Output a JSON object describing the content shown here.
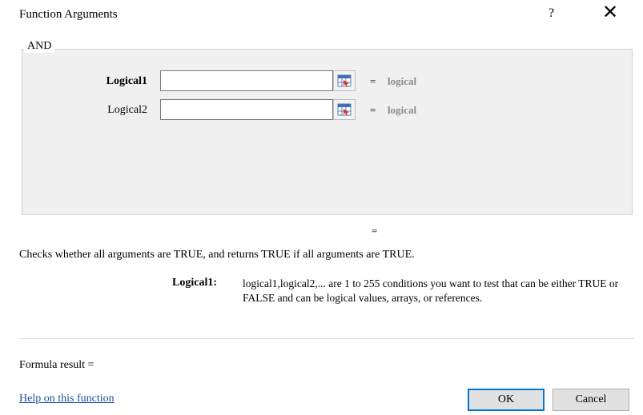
{
  "window": {
    "title": "Function Arguments",
    "help_glyph": "?",
    "close_glyph": "✕"
  },
  "group": {
    "label": "AND",
    "args": [
      {
        "label": "Logical1",
        "value": "",
        "eq": "=",
        "result": "logical",
        "bold": true
      },
      {
        "label": "Logical2",
        "value": "",
        "eq": "=",
        "result": "logical",
        "bold": false
      }
    ]
  },
  "function_result_eq": "=",
  "description": "Checks whether all arguments are TRUE, and returns TRUE if all arguments are TRUE.",
  "argument_help": {
    "label": "Logical1:",
    "text": "logical1,logical2,... are 1 to 255 conditions you want to test that can be either TRUE or FALSE and can be logical values, arrays, or references."
  },
  "formula_result": "Formula result =",
  "help_link": "Help on this function",
  "buttons": {
    "ok": "OK",
    "cancel": "Cancel"
  },
  "colors": {
    "accent": "#0078d7",
    "link": "#1a4f9c",
    "muted": "#8a8a8a"
  },
  "icons": {
    "ref_button": "range-select-icon"
  }
}
